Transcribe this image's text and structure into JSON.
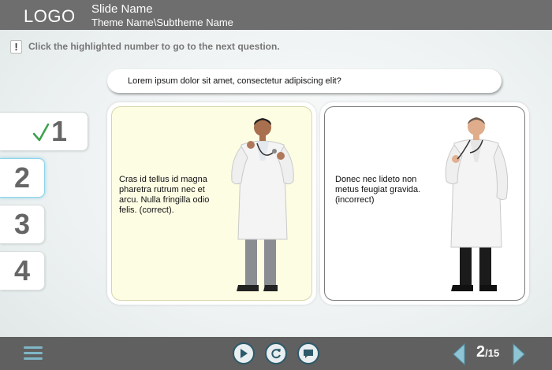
{
  "header": {
    "logo": "LOGO",
    "slide_name": "Slide Name",
    "theme_name": "Theme Name\\Subtheme Name"
  },
  "instruction": {
    "icon": "exclamation-icon",
    "text": "Click the highlighted number to go to the next question."
  },
  "question": "Lorem ipsum dolor sit amet, consectetur adipiscing elit?",
  "numbers": [
    {
      "label": "1",
      "state": "answered-correct"
    },
    {
      "label": "2",
      "state": "highlighted"
    },
    {
      "label": "3",
      "state": "default"
    },
    {
      "label": "4",
      "state": "default"
    }
  ],
  "answers": [
    {
      "text": "Cras id tellus id magna pharetra rutrum nec et arcu. Nulla fringilla odio felis. (correct).",
      "selected": true
    },
    {
      "text": "Donec nec lideto non metus feugiat gravida. (incorrect)",
      "selected": false
    }
  ],
  "footer": {
    "page_current": "2",
    "page_total": "/15",
    "buttons": [
      "play-icon",
      "replay-icon",
      "comment-icon"
    ]
  },
  "colors": {
    "header_bg": "#6e6e6e",
    "footer_bg": "#606060",
    "check_green": "#3aa14a",
    "accent_teal": "#2c5a6a",
    "selected_card_bg": "#fdfde4"
  }
}
